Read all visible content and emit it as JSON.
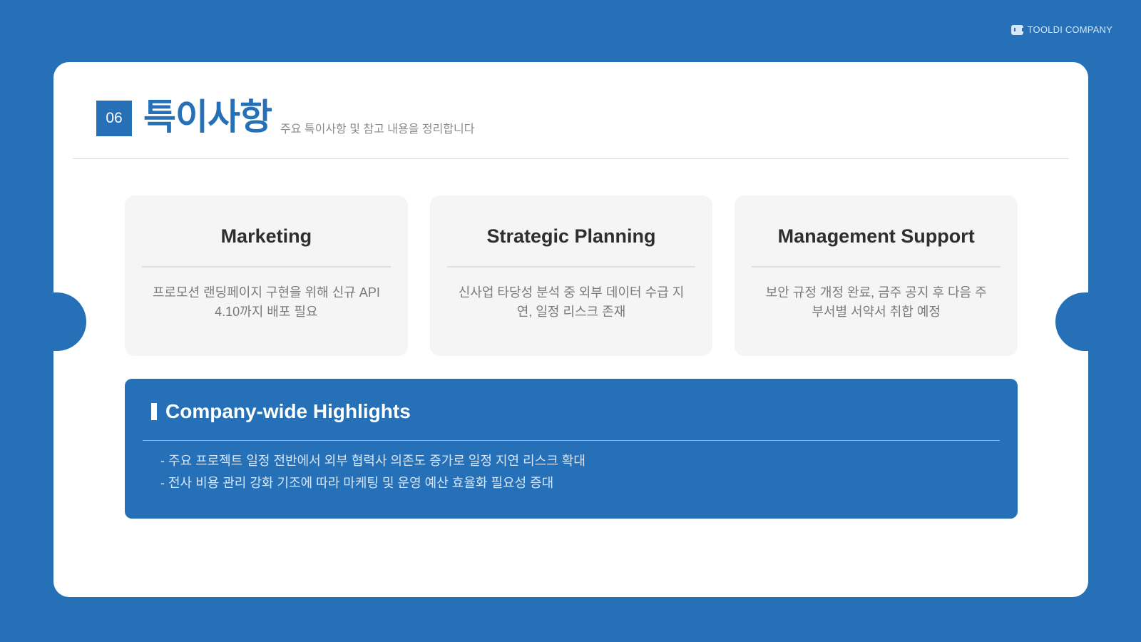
{
  "brand": {
    "icon": "chat-bubble-icon",
    "name": "TOOLDI COMPANY"
  },
  "header": {
    "number": "06",
    "title": "특이사항",
    "subtitle": "주요 특이사항 및 참고 내용을 정리합니다"
  },
  "departments": [
    {
      "name": "Marketing",
      "text": "프로모션 랜딩페이지 구현을 위해 신규 API 4.10까지 배포 필요"
    },
    {
      "name": "Strategic Planning",
      "text": "신사업 타당성 분석 중 외부 데이터 수급 지연, 일정 리스크 존재"
    },
    {
      "name": "Management Support",
      "text": "보안 규정 개정 완료, 금주 공지 후 다음 주 부서별 서약서 취합 예정"
    }
  ],
  "highlights": {
    "title": "Company-wide Highlights",
    "items": [
      "- 주요 프로젝트 일정 전반에서 외부 협력사 의존도 증가로 일정 지연 리스크 확대",
      "- 전사 비용 관리 강화 기조에 따라 마케팅 및 운영 예산 효율화 필요성 증대"
    ]
  },
  "colors": {
    "primary": "#2670b8",
    "card": "#ffffff",
    "panel": "#f5f5f5"
  }
}
